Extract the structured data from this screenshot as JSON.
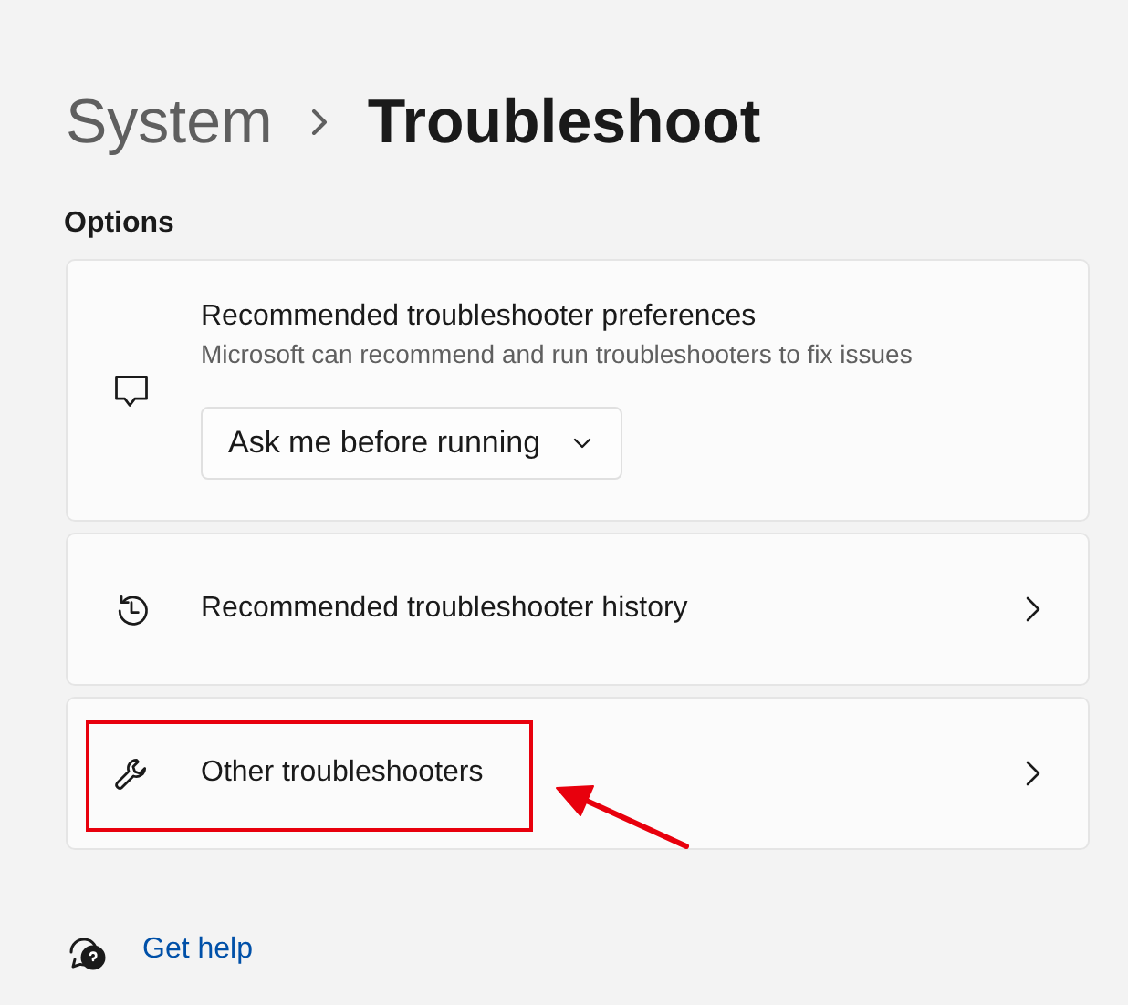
{
  "breadcrumb": [
    {
      "label": "System",
      "current": false
    },
    {
      "label": "Troubleshoot",
      "current": true
    }
  ],
  "section": "Options",
  "items": [
    {
      "kind": "dropdown",
      "title": "Recommended troubleshooter preferences",
      "description": "Microsoft can recommend and run troubleshooters to fix issues",
      "value": "Ask me before running",
      "highlighted": false
    },
    {
      "kind": "link",
      "title": "Recommended troubleshooter history",
      "highlighted": false
    },
    {
      "kind": "link",
      "title": "Other troubleshooters",
      "highlighted": true
    }
  ],
  "help_link": "Get help"
}
